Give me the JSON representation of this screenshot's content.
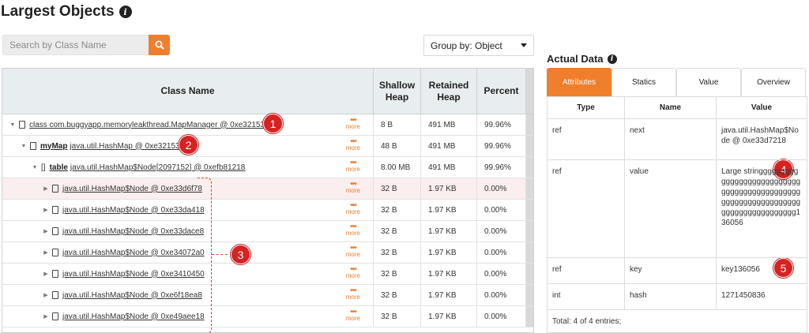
{
  "page": {
    "title": "Largest Objects"
  },
  "search": {
    "placeholder": "Search by Class Name"
  },
  "group_by": {
    "selected": "Group by: Object"
  },
  "table": {
    "headers": {
      "class_name": "Class Name",
      "shallow": "Shallow Heap",
      "retained": "Retained Heap",
      "percent": "Percent"
    },
    "more_label": "more",
    "rows": [
      {
        "prefix": "",
        "name": "class com.buggyapp.memoryleakthread.MapManager @ 0xe3215380",
        "shallow": "8 B",
        "retained": "491 MB",
        "percent": "99.96%"
      },
      {
        "prefix": "myMap",
        "name": "java.util.HashMap @ 0xe32153f0",
        "shallow": "48 B",
        "retained": "491 MB",
        "percent": "99.96%"
      },
      {
        "prefix": "table",
        "name": "java.util.HashMap$Node[2097152] @ 0xefb81218",
        "shallow": "8.00 MB",
        "retained": "491 MB",
        "percent": "99.96%"
      },
      {
        "prefix": "",
        "name": "java.util.HashMap$Node @ 0xe33d6f78",
        "shallow": "32 B",
        "retained": "1.97 KB",
        "percent": "0.00%"
      },
      {
        "prefix": "",
        "name": "java.util.HashMap$Node @ 0xe33da418",
        "shallow": "32 B",
        "retained": "1.97 KB",
        "percent": "0.00%"
      },
      {
        "prefix": "",
        "name": "java.util.HashMap$Node @ 0xe33dace8",
        "shallow": "32 B",
        "retained": "1.97 KB",
        "percent": "0.00%"
      },
      {
        "prefix": "",
        "name": "java.util.HashMap$Node @ 0xe34072a0",
        "shallow": "32 B",
        "retained": "1.97 KB",
        "percent": "0.00%"
      },
      {
        "prefix": "",
        "name": "java.util.HashMap$Node @ 0xe3410450",
        "shallow": "32 B",
        "retained": "1.97 KB",
        "percent": "0.00%"
      },
      {
        "prefix": "",
        "name": "java.util.HashMap$Node @ 0xe6f18ea8",
        "shallow": "32 B",
        "retained": "1.97 KB",
        "percent": "0.00%"
      },
      {
        "prefix": "",
        "name": "java.util.HashMap$Node @ 0xe49aee18",
        "shallow": "32 B",
        "retained": "1.97 KB",
        "percent": "0.00%"
      }
    ]
  },
  "badges": [
    "1",
    "2",
    "3",
    "4",
    "5"
  ],
  "actual_data": {
    "title": "Actual Data",
    "tabs": [
      "Attributes",
      "Statics",
      "Value",
      "Overview"
    ],
    "headers": {
      "type": "Type",
      "name": "Name",
      "value": "Value"
    },
    "rows": [
      {
        "type": "ref",
        "name": "next",
        "value": "java.util.HashMap$Node @ 0xe33d7218"
      },
      {
        "type": "ref",
        "name": "value",
        "value": "Large stringggggggggggggggggggggggggggggggggggggggggggggggggggggggggggggggggggggggggggggggg136056"
      },
      {
        "type": "ref",
        "name": "key",
        "value": "key136056"
      },
      {
        "type": "int",
        "name": "hash",
        "value": "1271450836"
      }
    ],
    "total": "Total: 4 of 4 entries;"
  },
  "colors": {
    "accent": "#f07f2d",
    "badge": "#d62222",
    "header_bg": "#e8edf0"
  }
}
